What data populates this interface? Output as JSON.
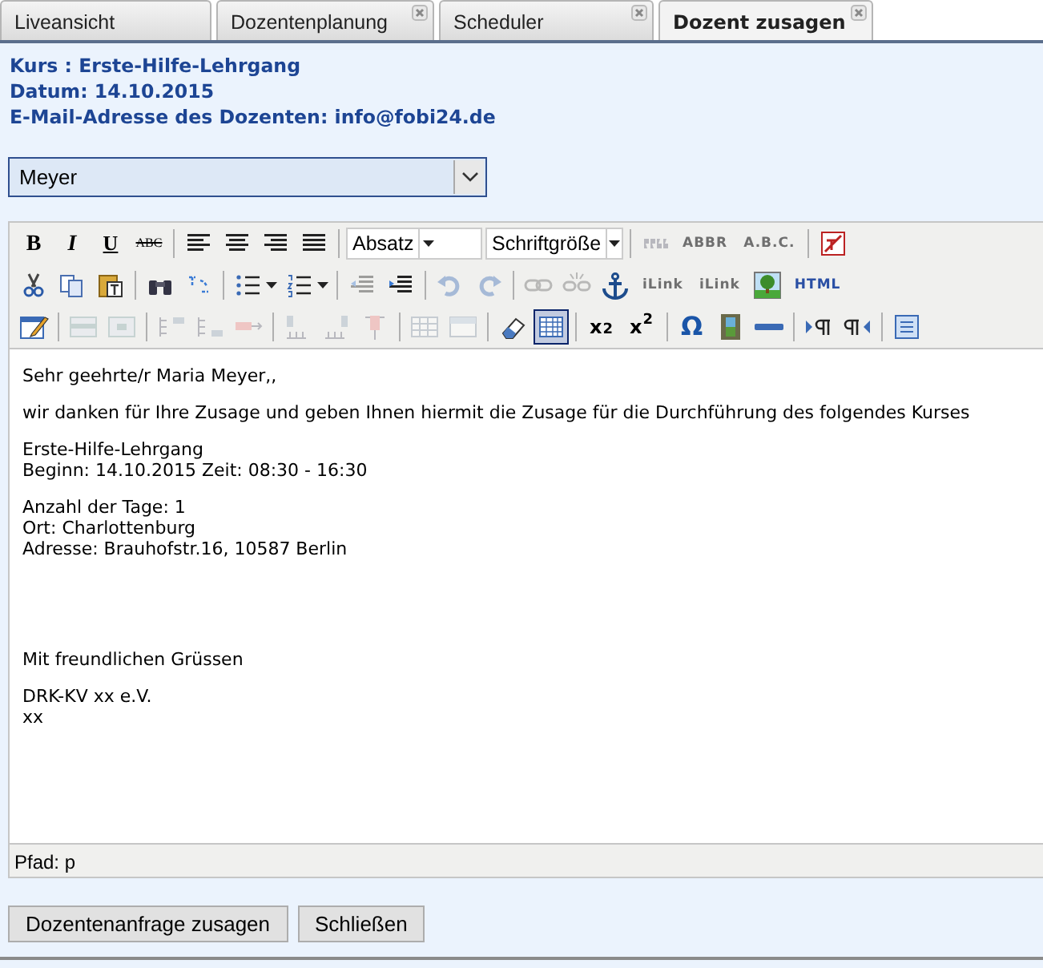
{
  "tabs": [
    {
      "label": "Liveansicht",
      "selected": false,
      "closable": false
    },
    {
      "label": "Dozentenplanung",
      "selected": false,
      "closable": true
    },
    {
      "label": "Scheduler",
      "selected": false,
      "closable": true
    },
    {
      "label": "Dozent zusagen",
      "selected": true,
      "closable": true
    }
  ],
  "header": {
    "lines": [
      "Kurs : Erste-Hilfe-Lehrgang",
      "Datum: 14.10.2015",
      "E-Mail-Adresse des Dozenten: info@fobi24.de"
    ]
  },
  "recipient_select": {
    "value": "Meyer"
  },
  "editor": {
    "toolbar_rows": [
      [
        {
          "kind": "bold",
          "label": "B",
          "disabled": false,
          "pressed": false
        },
        {
          "kind": "italic",
          "label": "I",
          "disabled": false,
          "pressed": false
        },
        {
          "kind": "underline",
          "label": "U",
          "disabled": false,
          "pressed": false
        },
        {
          "kind": "strikethrough",
          "label": "ABC",
          "disabled": false,
          "pressed": false
        },
        {
          "kind": "separator"
        },
        {
          "kind": "icon",
          "disabled": false,
          "pressed": false
        },
        {
          "kind": "icon",
          "disabled": false,
          "pressed": false
        },
        {
          "kind": "icon",
          "disabled": false,
          "pressed": false
        },
        {
          "kind": "icon",
          "disabled": false,
          "pressed": false
        },
        {
          "kind": "separator"
        },
        {
          "kind": "dropdown",
          "label": "Absatz"
        },
        {
          "kind": "dropdown",
          "label": "Schriftgröße"
        },
        {
          "kind": "separator"
        },
        {
          "kind": "icon",
          "disabled": true,
          "pressed": false
        },
        {
          "kind": "label",
          "label": "ABBR",
          "disabled": true,
          "pressed": false
        },
        {
          "kind": "label",
          "label": "A.B.C.",
          "disabled": true,
          "pressed": false
        },
        {
          "kind": "separator"
        },
        {
          "kind": "icon",
          "disabled": false,
          "pressed": false
        }
      ],
      [
        {
          "kind": "icon",
          "disabled": false,
          "pressed": false
        },
        {
          "kind": "icon",
          "disabled": false,
          "pressed": false
        },
        {
          "kind": "icon",
          "disabled": false,
          "pressed": false
        },
        {
          "kind": "separator"
        },
        {
          "kind": "icon",
          "disabled": false,
          "pressed": false
        },
        {
          "kind": "icon",
          "disabled": false,
          "pressed": false
        },
        {
          "kind": "separator"
        },
        {
          "kind": "split",
          "disabled": false,
          "pressed": false
        },
        {
          "kind": "split",
          "disabled": false,
          "pressed": false
        },
        {
          "kind": "separator"
        },
        {
          "kind": "icon",
          "disabled": true,
          "pressed": false
        },
        {
          "kind": "icon",
          "disabled": false,
          "pressed": false
        },
        {
          "kind": "separator"
        },
        {
          "kind": "icon",
          "disabled": true,
          "pressed": false
        },
        {
          "kind": "icon",
          "disabled": true,
          "pressed": false
        },
        {
          "kind": "separator"
        },
        {
          "kind": "icon",
          "disabled": true,
          "pressed": false
        },
        {
          "kind": "icon",
          "disabled": true,
          "pressed": false
        },
        {
          "kind": "icon",
          "disabled": false,
          "pressed": false
        },
        {
          "kind": "label",
          "label": "iLink",
          "disabled": true,
          "pressed": false
        },
        {
          "kind": "label",
          "label": "iLink",
          "disabled": true,
          "pressed": false
        },
        {
          "kind": "icon",
          "disabled": false,
          "pressed": false
        },
        {
          "kind": "label",
          "label": "HTML",
          "disabled": false,
          "pressed": false
        }
      ],
      [
        {
          "kind": "icon",
          "disabled": false,
          "pressed": false
        },
        {
          "kind": "separator"
        },
        {
          "kind": "icon",
          "disabled": true,
          "pressed": false
        },
        {
          "kind": "icon",
          "disabled": true,
          "pressed": false
        },
        {
          "kind": "separator"
        },
        {
          "kind": "icon",
          "disabled": true,
          "pressed": false
        },
        {
          "kind": "icon",
          "disabled": true,
          "pressed": false
        },
        {
          "kind": "icon",
          "disabled": true,
          "pressed": false
        },
        {
          "kind": "separator"
        },
        {
          "kind": "icon",
          "disabled": true,
          "pressed": false
        },
        {
          "kind": "icon",
          "disabled": true,
          "pressed": false
        },
        {
          "kind": "icon",
          "disabled": true,
          "pressed": false
        },
        {
          "kind": "separator"
        },
        {
          "kind": "icon",
          "disabled": true,
          "pressed": false
        },
        {
          "kind": "icon",
          "disabled": true,
          "pressed": false
        },
        {
          "kind": "separator"
        },
        {
          "kind": "icon",
          "disabled": false,
          "pressed": false
        },
        {
          "kind": "icon",
          "disabled": false,
          "pressed": true
        },
        {
          "kind": "separator"
        },
        {
          "kind": "label",
          "label": "x$_{2}$",
          "disabled": false,
          "pressed": false
        },
        {
          "kind": "label",
          "label": "x$^{2}$",
          "disabled": false,
          "pressed": false
        },
        {
          "kind": "separator"
        },
        {
          "kind": "label",
          "label": "Ω",
          "disabled": false,
          "pressed": false
        },
        {
          "kind": "icon",
          "disabled": false,
          "pressed": false
        },
        {
          "kind": "icon",
          "disabled": false,
          "pressed": false
        },
        {
          "kind": "separator"
        },
        {
          "kind": "icon",
          "disabled": false,
          "pressed": false
        },
        {
          "kind": "icon",
          "disabled": false,
          "pressed": false
        },
        {
          "kind": "separator"
        },
        {
          "kind": "icon",
          "disabled": false,
          "pressed": false
        }
      ]
    ],
    "content": {
      "paragraphs": [
        {
          "kind": "text",
          "lines": [
            "Sehr geehrte/r Maria Meyer,,"
          ]
        },
        {
          "kind": "text",
          "lines": [
            "wir danken für Ihre Zusage und geben Ihnen hiermit die Zusage für die Durchführung des folgendes Kurses"
          ]
        },
        {
          "kind": "text",
          "lines": [
            "Erste-Hilfe-Lehrgang",
            "Beginn: 14.10.2015 Zeit: 08:30 - 16:30"
          ]
        },
        {
          "kind": "text",
          "lines": [
            "Anzahl der Tage: 1",
            "Ort: Charlottenburg",
            "Adresse: Brauhofstr.16, 10587 Berlin"
          ]
        },
        {
          "kind": "blank"
        },
        {
          "kind": "blank"
        },
        {
          "kind": "text",
          "lines": [
            "Mit freundlichen Grüssen"
          ]
        },
        {
          "kind": "text",
          "lines": [
            "DRK-KV xx e.V.",
            "xx"
          ]
        }
      ]
    },
    "path": "Pfad: p"
  },
  "buttons": [
    "Dozentenanfrage zusagen",
    "Schließen"
  ]
}
